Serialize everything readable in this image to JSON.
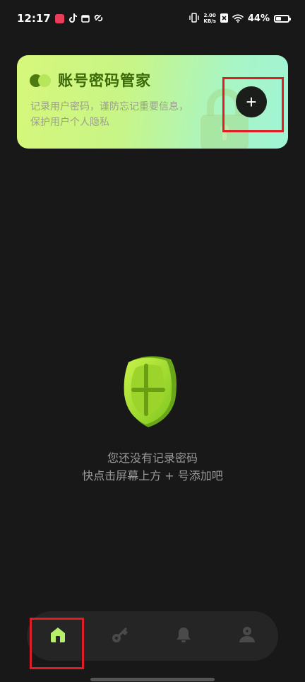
{
  "status_bar": {
    "time": "12:17",
    "net_speed_value": "2.00",
    "net_speed_unit": "KB/s",
    "battery_percent": "44%",
    "battery_level": 0.44
  },
  "header_card": {
    "title": "账号密码管家",
    "description": "记录用户密码，谨防忘记重要信息，保护用户个人隐私",
    "add_label": "+"
  },
  "empty_state": {
    "line1": "您还没有记录密码",
    "line2": "快点击屏幕上方 + 号添加吧"
  },
  "bottom_nav": {
    "items": [
      {
        "icon": "home-icon",
        "active": true
      },
      {
        "icon": "key-icon",
        "active": false
      },
      {
        "icon": "bell-icon",
        "active": false
      },
      {
        "icon": "user-icon",
        "active": false
      }
    ]
  },
  "colors": {
    "accent_green": "#b6f06a",
    "title_green": "#3c6a08",
    "highlight_red": "#e01d24",
    "background": "#181818"
  }
}
